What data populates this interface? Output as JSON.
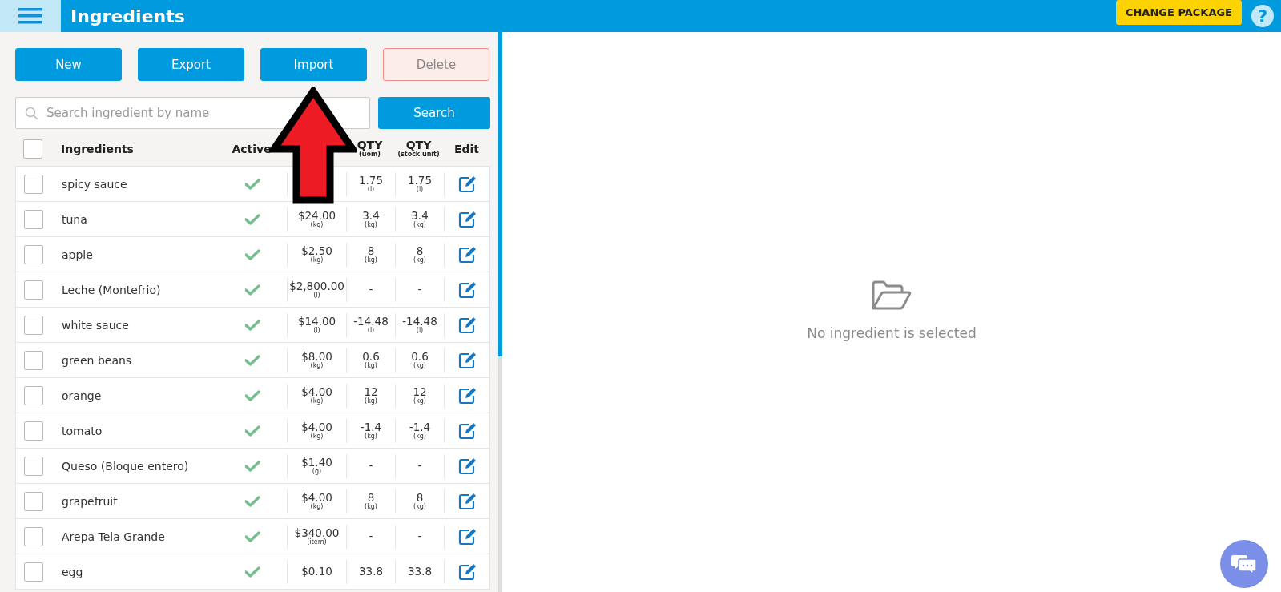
{
  "header": {
    "title": "Ingredients",
    "package_button": "CHANGE PACKAGE",
    "help": "?"
  },
  "toolbar": [
    {
      "label": "New",
      "disabled": false
    },
    {
      "label": "Export",
      "disabled": false
    },
    {
      "label": "Import",
      "disabled": false
    },
    {
      "label": "Delete",
      "disabled": true
    }
  ],
  "search": {
    "placeholder": "Search ingredient by name",
    "button": "Search"
  },
  "table": {
    "select_all": {
      "checked": false
    },
    "columns": [
      {
        "kind": "name",
        "label": "Ingredients"
      },
      {
        "kind": "active",
        "label": "Active"
      },
      {
        "kind": "qty_uom",
        "label": "QTY",
        "sub": "(uom)"
      },
      {
        "kind": "qty_stock",
        "label": "QTY",
        "sub": "(stock unit)"
      },
      {
        "kind": "edit",
        "label": "Edit"
      }
    ],
    "rows": [
      {
        "name": "spicy sauce",
        "checked": false,
        "active": true,
        "qty_uom": "1.75",
        "qty_uom_unit": "(l)",
        "qty_stock": "1.75",
        "qty_stock_unit": "(l)"
      },
      {
        "name": "tuna",
        "checked": false,
        "active": true,
        "cost": "$24.00",
        "cost_unit": "(kg)",
        "qty_uom": "3.4",
        "qty_uom_unit": "(kg)",
        "qty_stock": "3.4",
        "qty_stock_unit": "(kg)"
      },
      {
        "name": "apple",
        "checked": false,
        "active": true,
        "cost": "$2.50",
        "cost_unit": "(kg)",
        "qty_uom": "8",
        "qty_uom_unit": "(kg)",
        "qty_stock": "8",
        "qty_stock_unit": "(kg)"
      },
      {
        "name": "Leche (Montefrio)",
        "checked": false,
        "active": true,
        "cost": "$2,800.00",
        "cost_unit": "(l)",
        "qty_uom": "-",
        "qty_stock": "-"
      },
      {
        "name": "white sauce",
        "checked": false,
        "active": true,
        "cost": "$14.00",
        "cost_unit": "(l)",
        "qty_uom": "-14.48",
        "qty_uom_unit": "(l)",
        "qty_stock": "-14.48",
        "qty_stock_unit": "(l)"
      },
      {
        "name": "green beans",
        "checked": false,
        "active": true,
        "cost": "$8.00",
        "cost_unit": "(kg)",
        "qty_uom": "0.6",
        "qty_uom_unit": "(kg)",
        "qty_stock": "0.6",
        "qty_stock_unit": "(kg)"
      },
      {
        "name": "orange",
        "checked": false,
        "active": true,
        "cost": "$4.00",
        "cost_unit": "(kg)",
        "qty_uom": "12",
        "qty_uom_unit": "(kg)",
        "qty_stock": "12",
        "qty_stock_unit": "(kg)"
      },
      {
        "name": "tomato",
        "checked": false,
        "active": true,
        "cost": "$4.00",
        "cost_unit": "(kg)",
        "qty_uom": "-1.4",
        "qty_uom_unit": "(kg)",
        "qty_stock": "-1.4",
        "qty_stock_unit": "(kg)"
      },
      {
        "name": "Queso (Bloque entero)",
        "checked": false,
        "active": true,
        "cost": "$1.40",
        "cost_unit": "(g)",
        "qty_uom": "-",
        "qty_stock": "-"
      },
      {
        "name": "grapefruit",
        "checked": false,
        "active": true,
        "cost": "$4.00",
        "cost_unit": "(kg)",
        "qty_uom": "8",
        "qty_uom_unit": "(kg)",
        "qty_stock": "8",
        "qty_stock_unit": "(kg)"
      },
      {
        "name": "Arepa Tela Grande",
        "checked": false,
        "active": true,
        "cost": "$340.00",
        "cost_unit": "(item)",
        "qty_uom": "-",
        "qty_stock": "-"
      },
      {
        "name": "egg",
        "checked": false,
        "active": true,
        "cost": "$0.10",
        "qty_uom": "33.8",
        "qty_stock": "33.8"
      }
    ]
  },
  "detail": {
    "message": "No ingredient is selected"
  }
}
